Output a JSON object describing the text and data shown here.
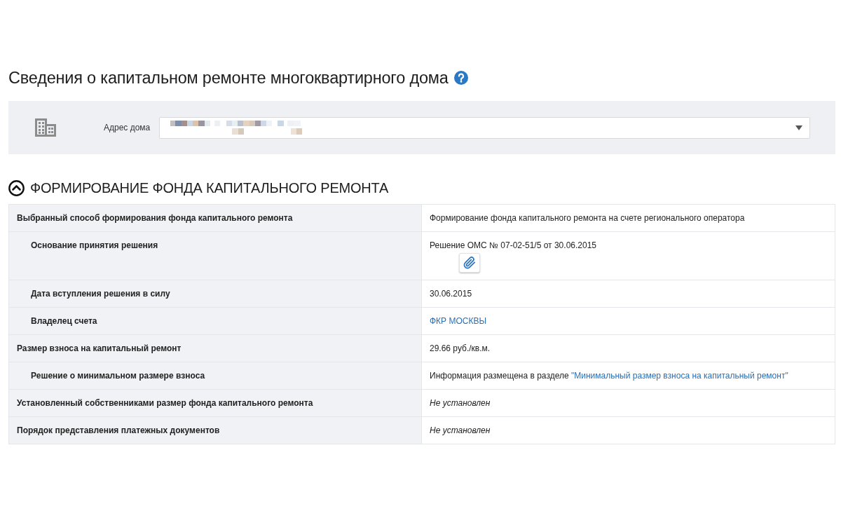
{
  "title": "Сведения о капитальном ремонте многоквартирного дома",
  "address": {
    "label": "Адрес дома"
  },
  "section": {
    "title": "ФОРМИРОВАНИЕ ФОНДА КАПИТАЛЬНОГО РЕМОНТА",
    "expanded": true,
    "rows": [
      {
        "label": "Выбранный способ формирования фонда капитального ремонта",
        "value": {
          "kind": "text",
          "text": "Формирование фонда капитального ремонта на счете регионального оператора"
        },
        "children": [
          {
            "label": "Основание принятия решения",
            "value": {
              "kind": "text",
              "text": "Решение ОМС № 07-02-51/5 от 30.06.2015",
              "attachment": true
            }
          },
          {
            "label": "Дата вступления решения в силу",
            "value": {
              "kind": "text",
              "text": "30.06.2015"
            }
          },
          {
            "label": "Владелец счета",
            "value": {
              "kind": "link",
              "text": "ФКР МОСКВЫ"
            }
          }
        ]
      },
      {
        "label": "Размер взноса на капитальный ремонт",
        "value": {
          "kind": "text",
          "text": "29.66 руб./кв.м."
        },
        "children": [
          {
            "label": "Решение о минимальном размере взноса",
            "value": {
              "kind": "text",
              "text": "Информация размещена в разделе",
              "link": "\"Минимальный размер взноса на капитальный ремонт\""
            }
          }
        ]
      },
      {
        "label": "Установленный собственниками размер фонда капитального ремонта",
        "value": {
          "kind": "note",
          "text": "Не установлен"
        }
      },
      {
        "label": "Порядок представления платежных документов",
        "value": {
          "kind": "note",
          "text": "Не установлен"
        }
      }
    ]
  }
}
